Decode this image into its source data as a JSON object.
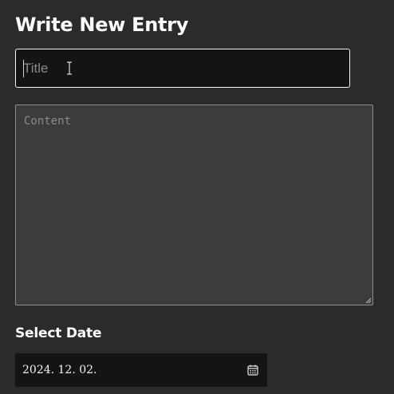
{
  "form": {
    "heading": "Write New Entry",
    "title_input": {
      "value": "",
      "placeholder": "Title"
    },
    "content_input": {
      "value": "",
      "placeholder": "Content"
    },
    "date_label": "Select Date",
    "date_value": "2024. 12. 02."
  },
  "icons": {
    "date_picker": "calendar-icon",
    "pointer": "text-cursor-icon",
    "grip": "resize-handle-icon"
  },
  "colors": {
    "background": "#2b2b2b",
    "input_background": "#141414",
    "textarea_background": "#3c3c3c",
    "focus_border": "#f4f4f4",
    "text": "#ffffff"
  }
}
